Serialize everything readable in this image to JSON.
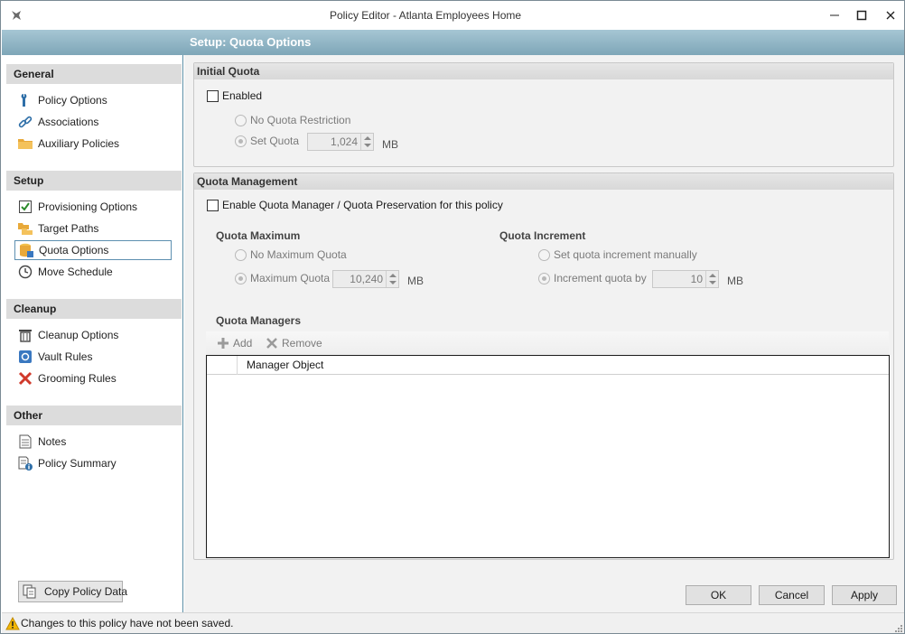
{
  "window": {
    "title": "Policy Editor - Atlanta Employees Home",
    "header": "Setup: Quota Options"
  },
  "sidebar": {
    "sections": [
      {
        "label": "General",
        "items": [
          {
            "label": "Policy Options",
            "icon": "wrench-icon"
          },
          {
            "label": "Associations",
            "icon": "link-icon"
          },
          {
            "label": "Auxiliary Policies",
            "icon": "folder-icon"
          }
        ]
      },
      {
        "label": "Setup",
        "items": [
          {
            "label": "Provisioning Options",
            "icon": "checkbox-icon"
          },
          {
            "label": "Target Paths",
            "icon": "folder-tree-icon"
          },
          {
            "label": "Quota Options",
            "icon": "database-icon",
            "selected": true
          },
          {
            "label": "Move Schedule",
            "icon": "clock-icon"
          }
        ]
      },
      {
        "label": "Cleanup",
        "items": [
          {
            "label": "Cleanup Options",
            "icon": "trash-icon"
          },
          {
            "label": "Vault Rules",
            "icon": "vault-icon"
          },
          {
            "label": "Grooming Rules",
            "icon": "x-icon"
          }
        ]
      },
      {
        "label": "Other",
        "items": [
          {
            "label": "Notes",
            "icon": "notes-icon"
          },
          {
            "label": "Policy Summary",
            "icon": "summary-icon"
          }
        ]
      }
    ],
    "copy_button": "Copy Policy Data"
  },
  "initial_quota": {
    "heading": "Initial Quota",
    "enabled_label": "Enabled",
    "enabled": false,
    "no_quota_label": "No Quota Restriction",
    "set_quota_label": "Set Quota",
    "set_quota_value": "1,024",
    "unit": "MB"
  },
  "quota_management": {
    "heading": "Quota Management",
    "enable_label": "Enable Quota Manager / Quota Preservation for this policy",
    "enabled": false,
    "maximum": {
      "heading": "Quota Maximum",
      "no_max_label": "No Maximum Quota",
      "max_label": "Maximum Quota",
      "max_value": "10,240",
      "unit": "MB"
    },
    "increment": {
      "heading": "Quota Increment",
      "manual_label": "Set quota increment manually",
      "increment_label": "Increment quota by",
      "increment_value": "10",
      "unit": "MB"
    },
    "managers": {
      "heading": "Quota Managers",
      "add_label": "Add",
      "remove_label": "Remove",
      "column": "Manager Object",
      "rows": []
    }
  },
  "buttons": {
    "ok": "OK",
    "cancel": "Cancel",
    "apply": "Apply"
  },
  "status": {
    "text": "Changes to this policy have not been saved."
  }
}
